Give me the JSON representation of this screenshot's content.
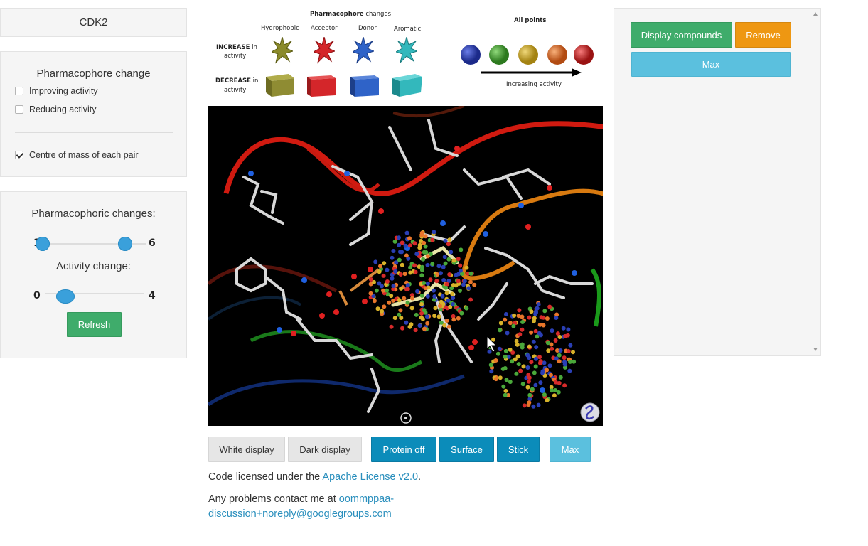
{
  "target": {
    "name": "CDK2"
  },
  "pharmacophore_panel": {
    "title": "Pharmacophore change",
    "options": [
      {
        "label": "Improving activity",
        "checked": false
      },
      {
        "label": "Reducing activity",
        "checked": false
      },
      {
        "label": "Centre of mass of each pair",
        "checked": true
      }
    ]
  },
  "sliders": {
    "pharm_label": "Pharmacophoric changes:",
    "pharm_min_value": "1",
    "pharm_max_value": "6",
    "activity_label": "Activity change:",
    "activity_min_value": "0",
    "activity_max_value": "4",
    "refresh_label": "Refresh"
  },
  "legend": {
    "title_bold": "Pharmacophore",
    "title_rest": " changes",
    "columns": [
      "Hydrophobic",
      "Acceptor",
      "Donor",
      "Aromatic"
    ],
    "increase_bold": "INCREASE",
    "increase_rest": " in",
    "increase_line2": "activity",
    "decrease_bold": "DECREASE",
    "decrease_rest": " in",
    "decrease_line2": "activity",
    "all_points": "All points",
    "increasing_activity": "Increasing activity",
    "colors": {
      "hydrophobic": "#8a8a2a",
      "acceptor": "#d4262a",
      "donor": "#2f63c8",
      "aromatic": "#33b8bc",
      "gradient": [
        "#2a3fb5",
        "#4aa83a",
        "#d8b22a",
        "#e8762a",
        "#d62a2a"
      ]
    }
  },
  "viewer_buttons": {
    "white_display": "White display",
    "dark_display": "Dark display",
    "protein_off": "Protein off",
    "surface": "Surface",
    "stick": "Stick",
    "max": "Max"
  },
  "right_panel": {
    "display_compounds": "Display compounds",
    "remove": "Remove",
    "max": "Max"
  },
  "footer": {
    "license_prefix": "Code licensed under the ",
    "license_link": "Apache License v2.0",
    "license_suffix": ".",
    "contact_prefix": "Any problems contact me at ",
    "contact_link": "oommppaa-discussion+noreply@googlegroups.com"
  }
}
